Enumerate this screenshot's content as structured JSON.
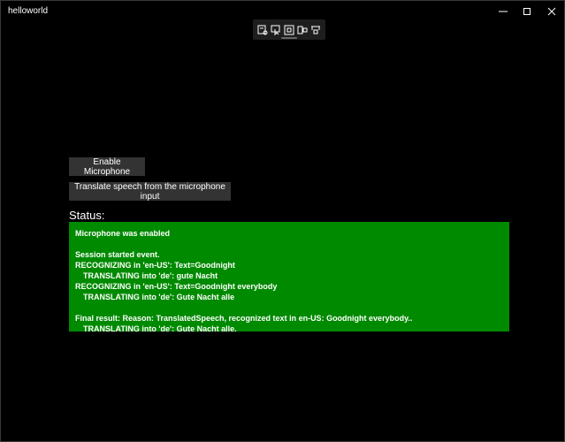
{
  "window": {
    "title": "helloworld"
  },
  "icons": {
    "minimize": "minimize-icon",
    "maximize": "maximize-icon",
    "close": "close-icon",
    "debug_toolbar": [
      "live-visual-tree-icon",
      "select-element-icon",
      "display-layout-adorners-icon",
      "track-focus-icon",
      "xaml-hot-reload-icon"
    ]
  },
  "buttons": {
    "enable_microphone": "Enable Microphone",
    "translate_speech": "Translate speech from the microphone input"
  },
  "status": {
    "label": "Status:",
    "lines": [
      "Microphone was enabled",
      "",
      "Session started event.",
      "RECOGNIZING in 'en-US': Text=Goodnight",
      "TRANSLATING into 'de': gute Nacht",
      "RECOGNIZING in 'en-US': Text=Goodnight everybody",
      "TRANSLATING into 'de': Gute Nacht alle",
      "",
      "Final result: Reason: TranslatedSpeech, recognized text in en-US: Goodnight everybody..",
      "TRANSLATING into 'de': Gute Nacht alle."
    ]
  },
  "colors": {
    "status_background": "#008a00",
    "button_background": "#333333",
    "window_background": "#000000"
  }
}
